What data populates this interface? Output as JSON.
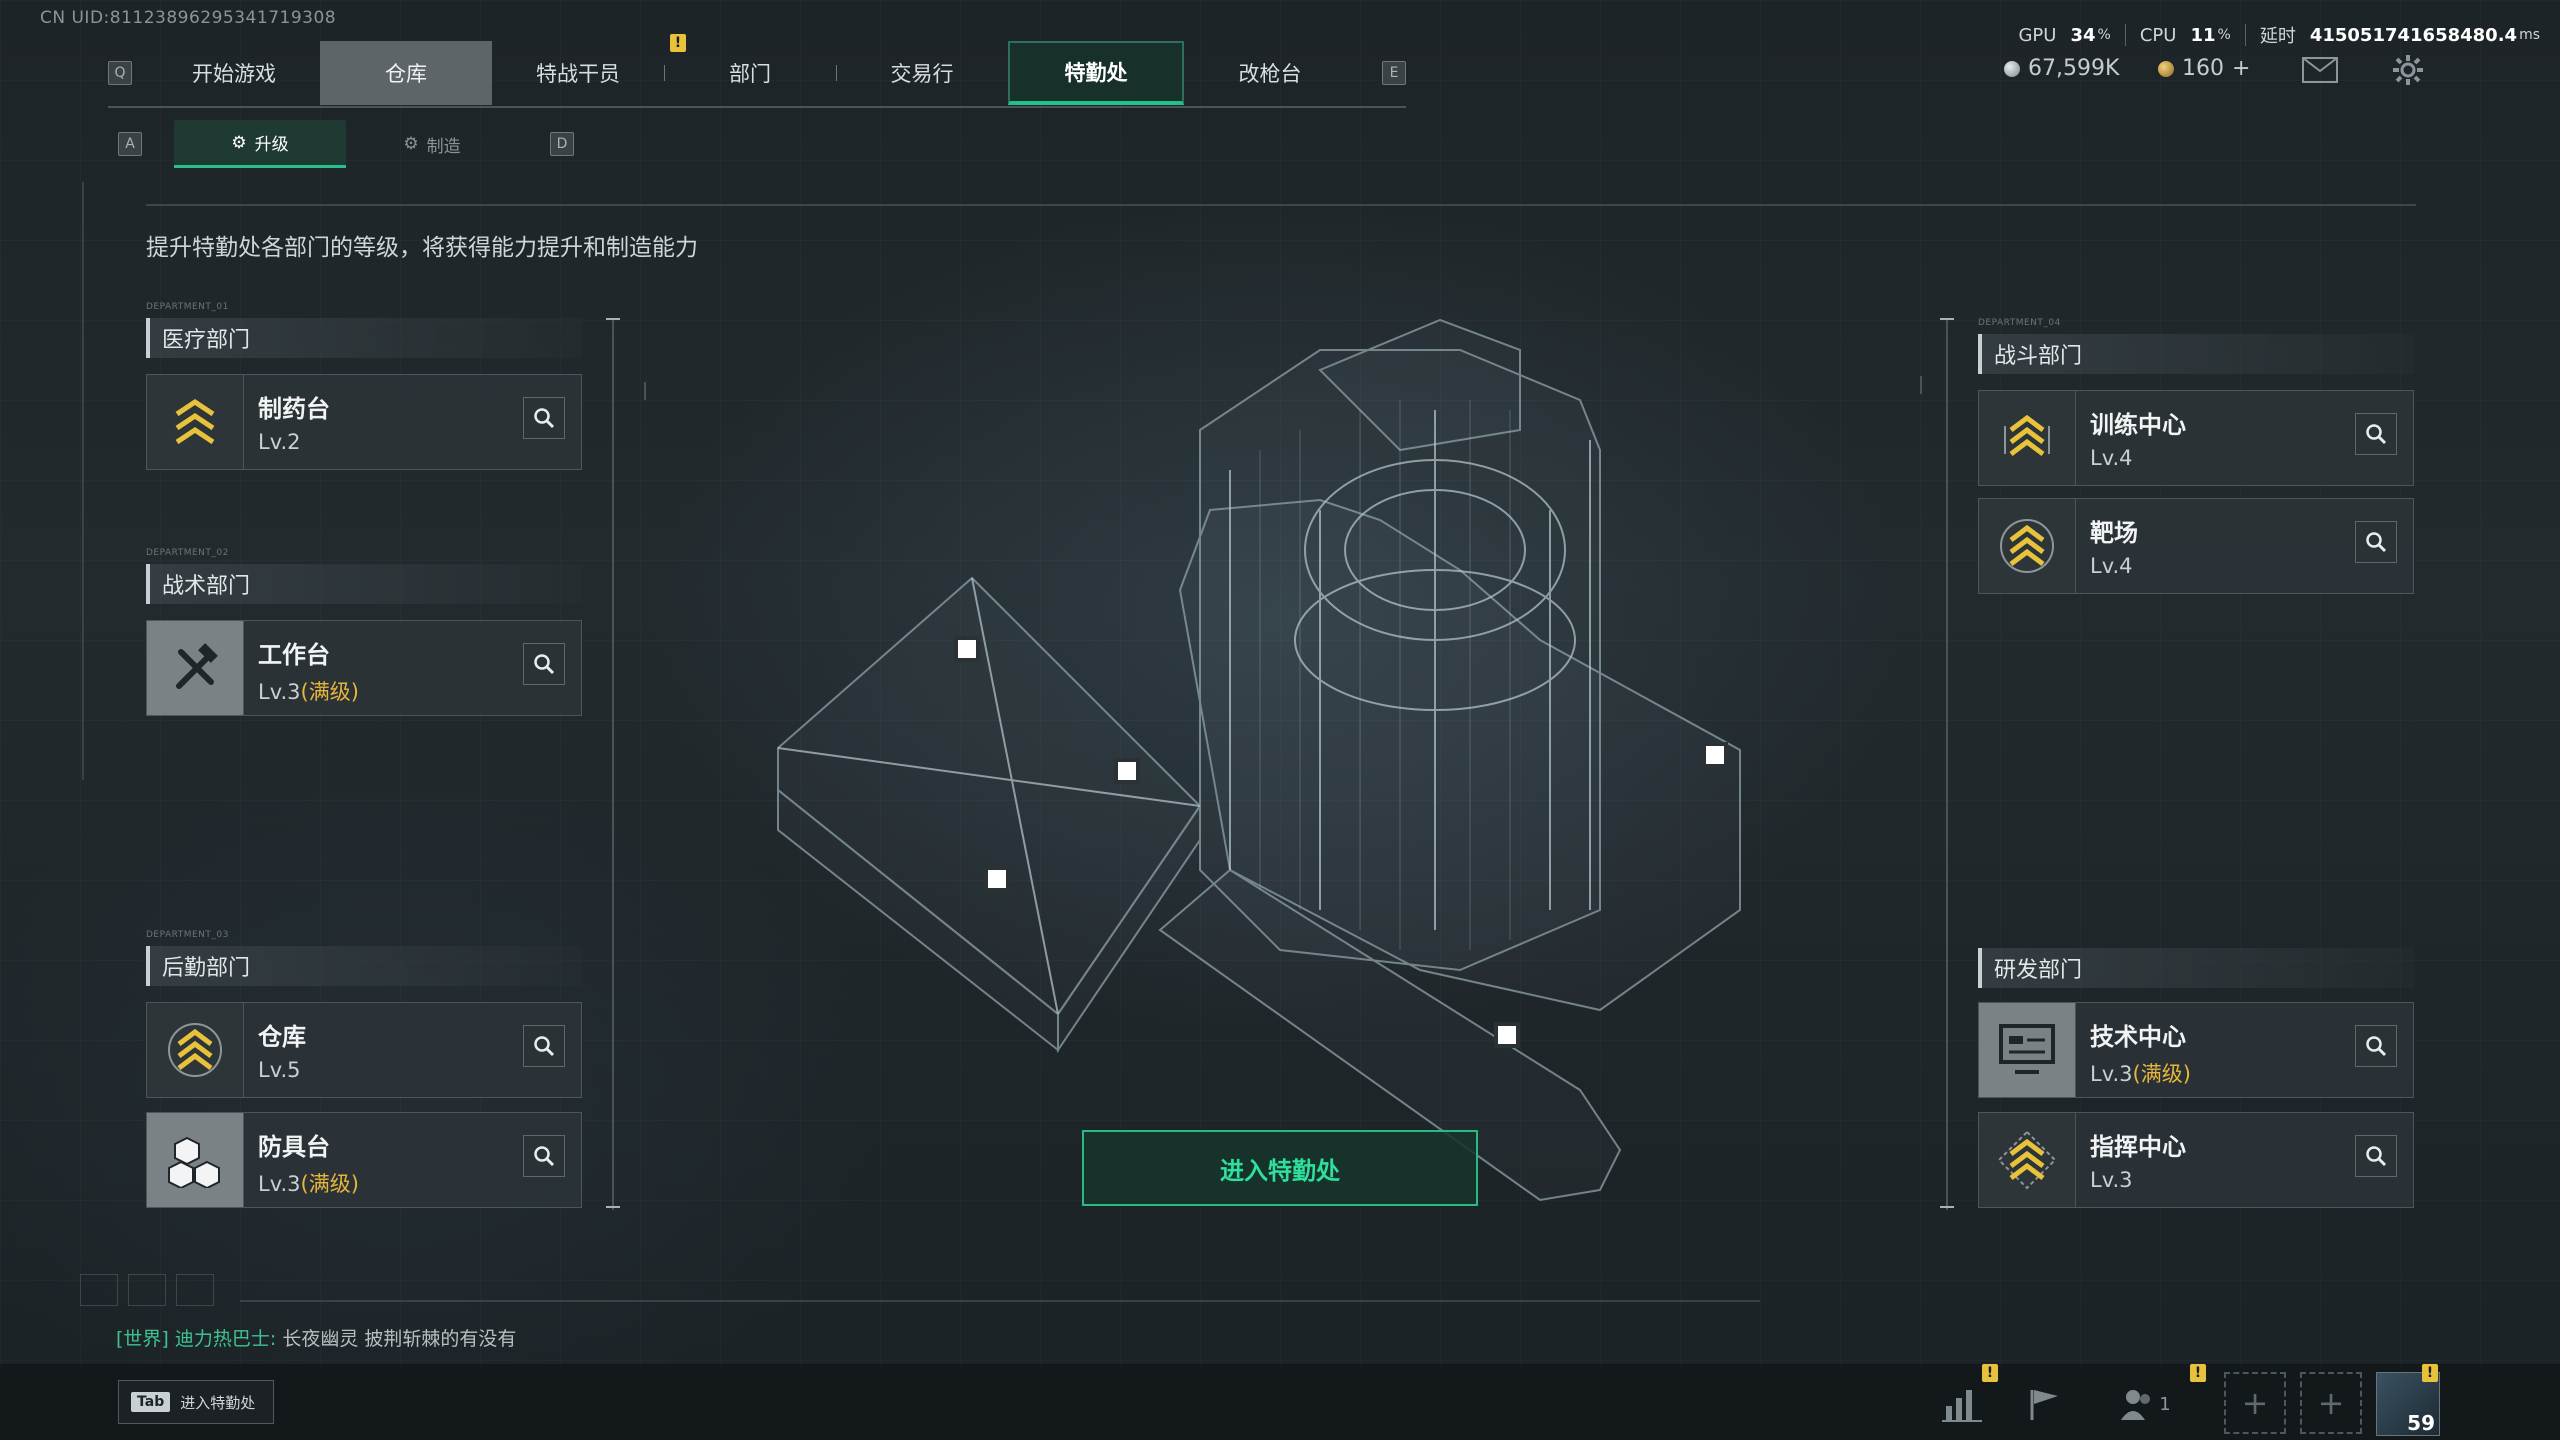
{
  "uid": "CN UID:81123896295341719308",
  "nav": {
    "left_key": "Q",
    "right_key": "E",
    "tabs": [
      {
        "label": "开始游戏"
      },
      {
        "label": "仓库"
      },
      {
        "label": "特战干员"
      },
      {
        "label": "部门"
      },
      {
        "label": "交易行"
      },
      {
        "label": "特勤处"
      },
      {
        "label": "改枪台"
      }
    ],
    "warn_mark": "!"
  },
  "stats": {
    "gpu_label": "GPU",
    "gpu_value": "34",
    "gpu_unit": "%",
    "cpu_label": "CPU",
    "cpu_value": "11",
    "cpu_unit": "%",
    "latency_label": "延时",
    "latency_value": "415051741658480.4",
    "latency_unit": "ms"
  },
  "currency": {
    "silver": "67,599K",
    "gold": "160",
    "gold_add": "+"
  },
  "subtabs": {
    "left_key": "A",
    "right_key": "D",
    "upgrade": "升级",
    "craft": "制造"
  },
  "headline": "提升特勤处各部门的等级，将获得能力提升和制造能力",
  "departments": {
    "medical": {
      "tag": "DEPARTMENT_01",
      "title": "医疗部门",
      "items": [
        {
          "name": "制药台",
          "level": "Lv.2",
          "max": ""
        }
      ]
    },
    "tactical": {
      "tag": "DEPARTMENT_02",
      "title": "战术部门",
      "items": [
        {
          "name": "工作台",
          "level": "Lv.3",
          "max": "(满级)"
        }
      ]
    },
    "logistics": {
      "tag": "DEPARTMENT_03",
      "title": "后勤部门",
      "items": [
        {
          "name": "仓库",
          "level": "Lv.5",
          "max": ""
        },
        {
          "name": "防具台",
          "level": "Lv.3",
          "max": "(满级)"
        }
      ]
    },
    "combat": {
      "tag": "DEPARTMENT_04",
      "title": "战斗部门",
      "items": [
        {
          "name": "训练中心",
          "level": "Lv.4",
          "max": ""
        },
        {
          "name": "靶场",
          "level": "Lv.4",
          "max": ""
        }
      ]
    },
    "research": {
      "title": "研发部门",
      "items": [
        {
          "name": "技术中心",
          "level": "Lv.3",
          "max": "(满级)"
        },
        {
          "name": "指挥中心",
          "level": "Lv.3",
          "max": ""
        }
      ]
    }
  },
  "enter_button": "进入特勤处",
  "chat": {
    "channel": "[世界]",
    "user": "迪力热巴士:",
    "message": "长夜幽灵 披荆斩棘的有没有"
  },
  "tab_hint": {
    "key": "Tab",
    "label": "进入特勤处"
  },
  "bottom": {
    "friends_count": "1",
    "level": "59",
    "slot_plus": "+"
  },
  "colors": {
    "accent": "#26c08c",
    "warning": "#e9c23c",
    "maxed": "#e6b63a",
    "panel": "#2c3438"
  }
}
